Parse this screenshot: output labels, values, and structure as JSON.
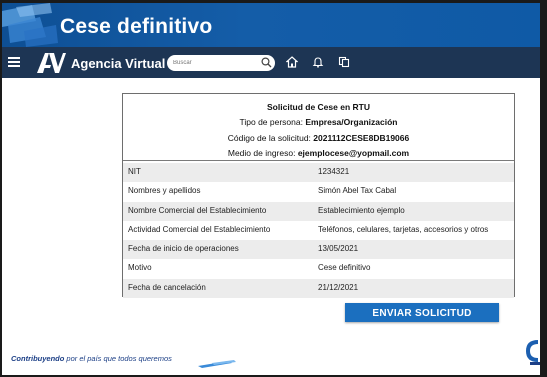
{
  "header": {
    "title": "Cese definitivo"
  },
  "navbar": {
    "brand": "Agencia Virtual",
    "search_placeholder": "Buscar",
    "icons": [
      "menu-icon",
      "search-icon",
      "home-icon",
      "bell-icon",
      "copy-icon"
    ]
  },
  "card": {
    "title": "Solicitud de Cese en RTU",
    "header_fields": [
      {
        "label": "Tipo de persona:",
        "value": "Empresa/Organización"
      },
      {
        "label": "Código de la solicitud:",
        "value": "2021112CESE8DB19066"
      },
      {
        "label": "Medio de ingreso:",
        "value": "ejemplocese@yopmail.com"
      }
    ],
    "rows": [
      {
        "label": "NIT",
        "value": "1234321"
      },
      {
        "label": "Nombres y apellidos",
        "value": "Simón Abel Tax Cabal"
      },
      {
        "label": "Nombre Comercial del Establecimiento",
        "value": "Establecimiento ejemplo"
      },
      {
        "label": "Actividad Comercial del Establecimiento",
        "value": "Teléfonos, celulares, tarjetas, accesorios y otros"
      },
      {
        "label": "Fecha de inicio de operaciones",
        "value": "13/05/2021"
      },
      {
        "label": "Motivo",
        "value": "Cese definitivo"
      },
      {
        "label": "Fecha de cancelación",
        "value": "21/12/2021"
      }
    ]
  },
  "actions": {
    "submit_label": "ENVIAR SOLICITUD"
  },
  "footer": {
    "slogan_bold": "Contribuyendo",
    "slogan_rest": " por el país que todos queremos"
  },
  "colors": {
    "banner": "#145da8",
    "navbar": "#1d3554",
    "button": "#1b6fbf",
    "footer_text": "#1c3f86"
  }
}
